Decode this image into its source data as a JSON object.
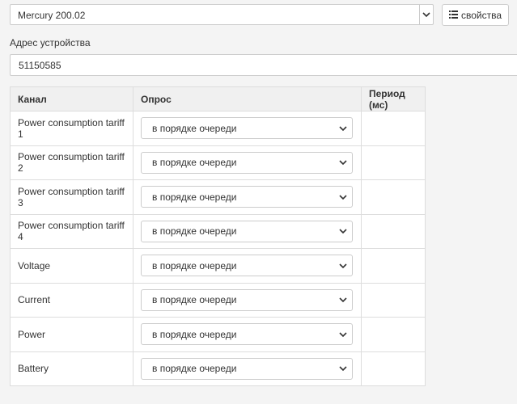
{
  "device": {
    "selected": "Mercury 200.02"
  },
  "properties_button": {
    "label": "свойства"
  },
  "address": {
    "label": "Адрес устройства",
    "value": "51150585"
  },
  "table": {
    "headers": [
      "Канал",
      "Опрос",
      "Период (мс)"
    ],
    "rows": [
      {
        "channel": "Power consumption tariff 1",
        "poll": "в порядке очереди",
        "period": ""
      },
      {
        "channel": "Power consumption tariff 2",
        "poll": "в порядке очереди",
        "period": ""
      },
      {
        "channel": "Power consumption tariff 3",
        "poll": "в порядке очереди",
        "period": ""
      },
      {
        "channel": "Power consumption tariff 4",
        "poll": "в порядке очереди",
        "period": ""
      },
      {
        "channel": "Voltage",
        "poll": "в порядке очереди",
        "period": ""
      },
      {
        "channel": "Current",
        "poll": "в порядке очереди",
        "period": ""
      },
      {
        "channel": "Power",
        "poll": "в порядке очереди",
        "period": ""
      },
      {
        "channel": "Battery",
        "poll": "в порядке очереди",
        "period": ""
      }
    ]
  }
}
